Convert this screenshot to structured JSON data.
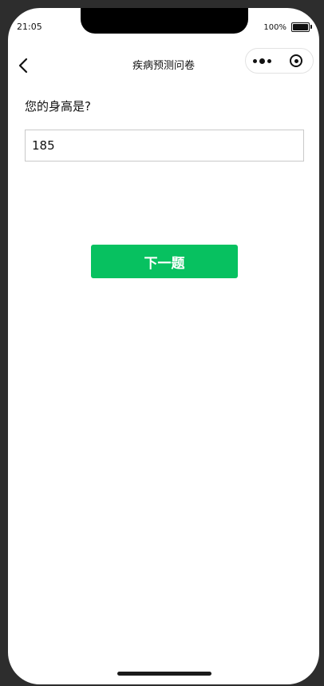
{
  "status_bar": {
    "time": "21:05",
    "battery": "100%"
  },
  "nav": {
    "title": "疾病预测问卷",
    "back_icon": "back-chevron-icon",
    "more_icon": "more-dots-icon",
    "close_icon": "target-close-icon"
  },
  "question": {
    "text": "您的身高是?",
    "answer_value": "185"
  },
  "actions": {
    "next_label": "下一题"
  },
  "colors": {
    "accent": "#07c160"
  }
}
